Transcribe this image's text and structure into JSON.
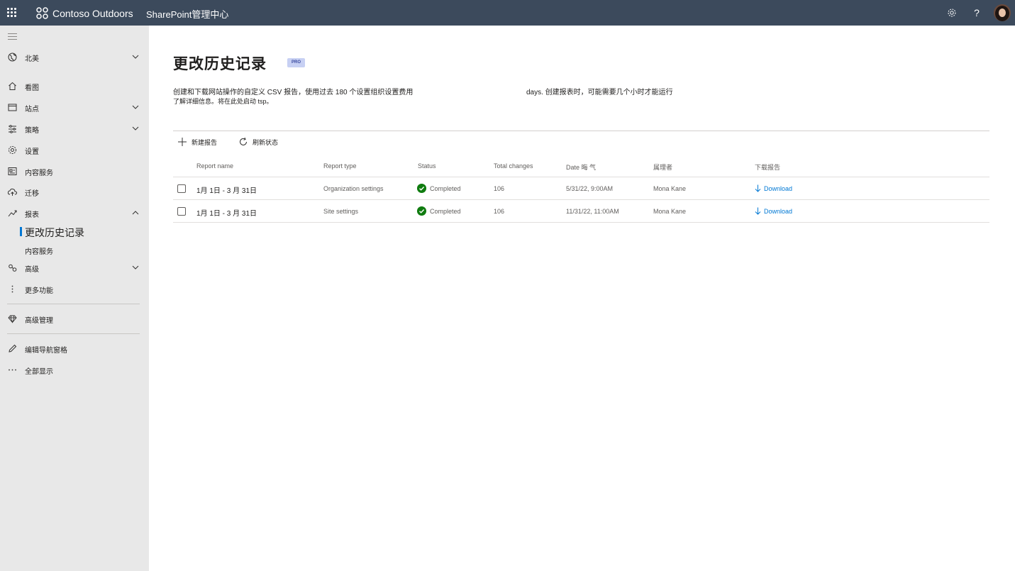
{
  "topbar": {
    "brand_name": "Contoso Outdoors",
    "app_name": "SharePoint管理中心",
    "icons": [
      "waffle-icon",
      "contoso-logo",
      "settings-icon",
      "help-icon",
      "avatar"
    ],
    "help_glyph": "?",
    "background": "#3c4a5c"
  },
  "sidebar": {
    "background": "#e8e8e8",
    "items": [
      {
        "label": "北美",
        "icon": "globe-icon",
        "chevron": "down"
      },
      {
        "label": "看图",
        "icon": "home-icon"
      },
      {
        "label": "站点",
        "icon": "sites-icon",
        "chevron": "down"
      },
      {
        "label": "策略",
        "icon": "policies-icon",
        "chevron": "down"
      },
      {
        "label": "设置",
        "icon": "settings-icon"
      },
      {
        "label": "内容服务",
        "icon": "content-services-icon"
      },
      {
        "label": "迁移",
        "icon": "migration-icon"
      },
      {
        "label": "报表",
        "icon": "reports-icon",
        "chevron": "up"
      },
      {
        "label": "高级",
        "icon": "advanced-icon",
        "chevron": "down"
      },
      {
        "label": "更多功能",
        "icon": "more-features-icon"
      },
      {
        "label": "高级管理",
        "icon": "diamond-icon"
      },
      {
        "label": "编辑导航窗格",
        "icon": "edit-icon"
      },
      {
        "label": "全部显示",
        "icon": "ellipsis-icon"
      }
    ],
    "reports_sub": [
      {
        "label": "更改历史记录",
        "active": true
      },
      {
        "label": "内容服务",
        "active": false
      }
    ]
  },
  "main": {
    "title": "更改历史记录",
    "badge": "PRO",
    "description_line1_a": "创建和下载网站操作的自定义 CSV 报告，使用过去 180 个设置组织设置费用",
    "description_line1_b": "days. 创建报表时，可能需要几个小时才能运行",
    "description_line2": "了解详细信息。将在此处启动 tsp。",
    "commands": {
      "new_report": "新建报告",
      "refresh": "刷新状态"
    },
    "table": {
      "headers": {
        "name": "Report name",
        "type": "Report type",
        "status": "Status",
        "total": "Total changes",
        "date": "Date 晦 气",
        "manager": "属理者",
        "download": "下载报告"
      },
      "rows": [
        {
          "name": "1月 1日 - 3 月 31日",
          "type": "Organization settings",
          "status": "Completed",
          "total": "106",
          "date": "5/31/22, 9:00AM",
          "manager": "Mona Kane",
          "download": "Download"
        },
        {
          "name": "1月 1日 - 3 月 31日",
          "type": "Site settings",
          "status": "Completed",
          "total": "106",
          "date": "11/31/22, 11:00AM",
          "manager": "Mona Kane",
          "download": "Download"
        }
      ]
    }
  },
  "colors": {
    "accent": "#0078d4",
    "success": "#107c10",
    "badge_bg": "#c7d0f3"
  }
}
